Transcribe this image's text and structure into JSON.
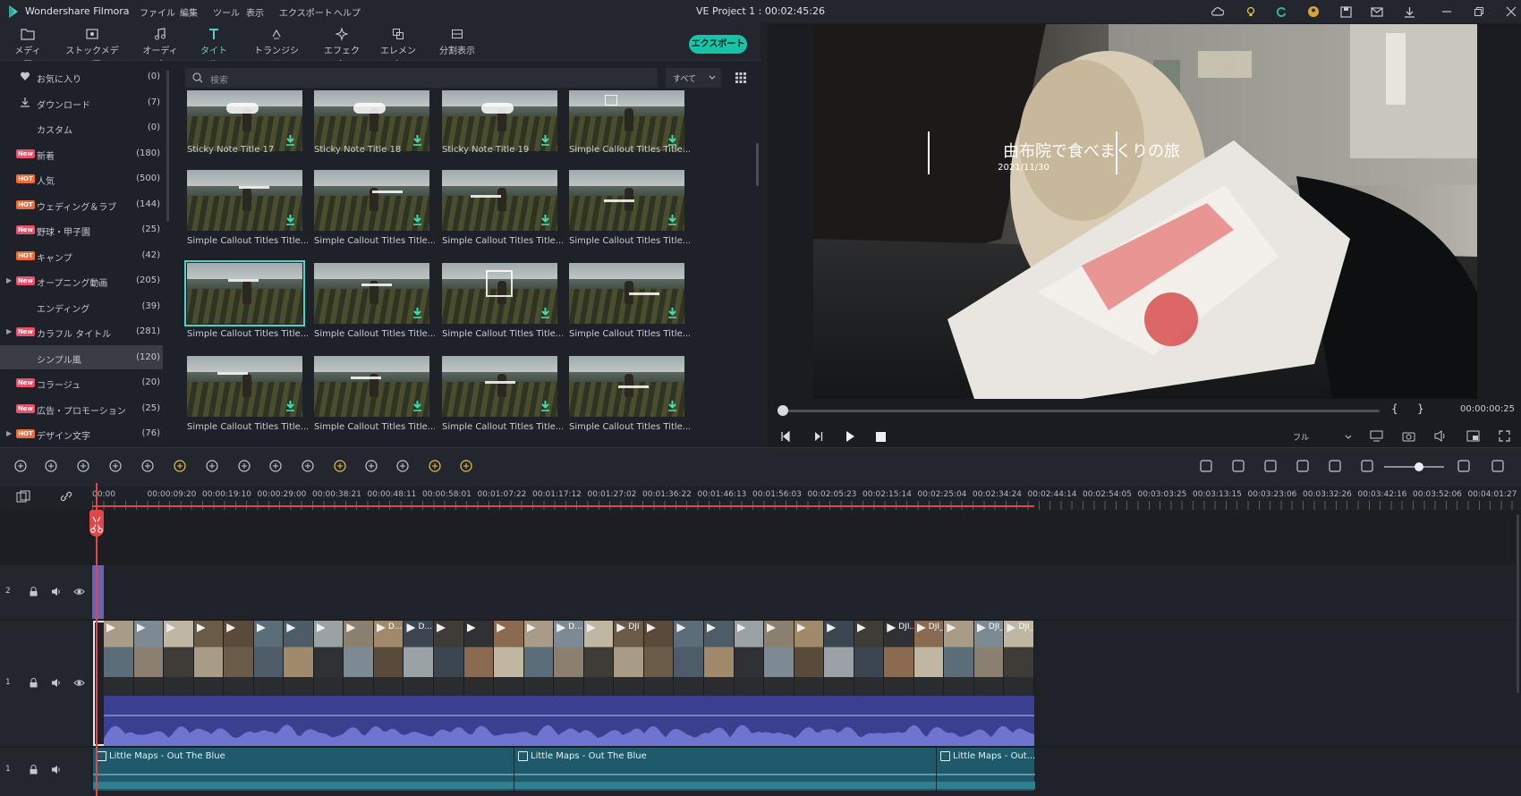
{
  "app": {
    "name": "Wondershare Filmora",
    "project_title": "VE Project 1 : 00:02:45:26"
  },
  "menu": [
    "ファイル",
    "編集",
    "ツール",
    "表示",
    "エクスポート",
    "ヘルプ"
  ],
  "tabs": [
    {
      "label": "メディア",
      "icon": "folder-icon"
    },
    {
      "label": "ストックメディア",
      "icon": "stock-media-icon"
    },
    {
      "label": "オーディオ",
      "icon": "music-note-icon"
    },
    {
      "label": "タイトル",
      "icon": "title-t-icon"
    },
    {
      "label": "トランジション",
      "icon": "transition-icon"
    },
    {
      "label": "エフェクト",
      "icon": "effect-icon"
    },
    {
      "label": "エレメント",
      "icon": "element-icon"
    },
    {
      "label": "分割表示",
      "icon": "split-screen-icon"
    }
  ],
  "active_tab": "タイトル",
  "export_label": "エクスポート",
  "sidebar": [
    {
      "label": "お気に入り",
      "count": "(0)",
      "icon": "heart-icon"
    },
    {
      "label": "ダウンロード",
      "count": "(7)",
      "icon": "download-icon"
    },
    {
      "label": "カスタム",
      "count": "(0)"
    },
    {
      "label": "新着",
      "count": "(180)",
      "badge": "New"
    },
    {
      "label": "人気",
      "count": "(500)",
      "badge": "HOT"
    },
    {
      "label": "ウェディング＆ラブ",
      "count": "(144)",
      "badge": "HOT"
    },
    {
      "label": "野球・甲子園",
      "count": "(25)",
      "badge": "New"
    },
    {
      "label": "キャンプ",
      "count": "(42)",
      "badge": "HOT"
    },
    {
      "label": "オープニング動画",
      "count": "(205)",
      "badge": "New",
      "expand": true
    },
    {
      "label": "エンディング",
      "count": "(39)"
    },
    {
      "label": "カラフル タイトル",
      "count": "(281)",
      "badge": "New",
      "expand": true
    },
    {
      "label": "シンプル風",
      "count": "(120)",
      "selected": true
    },
    {
      "label": "コラージュ",
      "count": "(20)",
      "badge": "New"
    },
    {
      "label": "広告・プロモーション",
      "count": "(25)",
      "badge": "New"
    },
    {
      "label": "デザイン文字",
      "count": "(76)",
      "badge": "HOT",
      "expand": true
    }
  ],
  "search": {
    "placeholder": "検索",
    "filter": "すべて"
  },
  "titles": [
    "Sticky Note Title 17",
    "Sticky Note Title 18",
    "Sticky Note Title 19",
    "Simple Callout Titles Title...",
    "Simple Callout Titles Title...",
    "Simple Callout Titles Title...",
    "Simple Callout Titles Title...",
    "Simple Callout Titles Title...",
    "Simple Callout Titles Title...",
    "Simple Callout Titles Title...",
    "Simple Callout Titles Title...",
    "Simple Callout Titles Title...",
    "Simple Callout Titles Title...",
    "Simple Callout Titles Title...",
    "Simple Callout Titles Title...",
    "Simple Callout Titles Title..."
  ],
  "preview": {
    "overlay_title": "由布院で食べまくりの旅",
    "overlay_date": "2021/11/30",
    "timecode": "00:00:00:25",
    "zoom": "フル",
    "bracket_in": "{",
    "bracket_out": "}"
  },
  "ruler": [
    "00:00",
    "00:00:09:20",
    "00:00:19:10",
    "00:00:29:00",
    "00:00:38:21",
    "00:00:48:11",
    "00:00:58:01",
    "00:01:07:22",
    "00:01:17:12",
    "00:01:27:02",
    "00:01:36:22",
    "00:01:46:13",
    "00:01:56:03",
    "00:02:05:23",
    "00:02:15:14",
    "00:02:25:04",
    "00:02:34:24",
    "00:02:44:14",
    "00:02:54:05",
    "00:03:03:25",
    "00:03:13:15",
    "00:03:23:06",
    "00:03:32:26",
    "00:03:42:16",
    "00:03:52:06",
    "00:04:01:27",
    "00:04"
  ],
  "tracks": {
    "video2": "2",
    "video1": "1",
    "audio1": "1"
  },
  "clips": [
    "",
    "",
    "",
    "",
    "",
    "",
    "",
    "",
    "",
    "D...",
    "D...",
    "",
    "",
    "",
    "",
    "D...",
    "",
    "DJI",
    "",
    "",
    "",
    "",
    "",
    "",
    "",
    "",
    "DJI...",
    "DJI_0...",
    "",
    "DJI_0498",
    "DJI_0..."
  ],
  "audio_clips": [
    "Little Maps - Out The Blue",
    "Little Maps - Out The Blue",
    "Little Maps - Out..."
  ],
  "colors": {
    "accent": "#4fd3c4",
    "export": "#17c4a8",
    "playhead": "#e04848",
    "audio": "#1e5a6b"
  }
}
